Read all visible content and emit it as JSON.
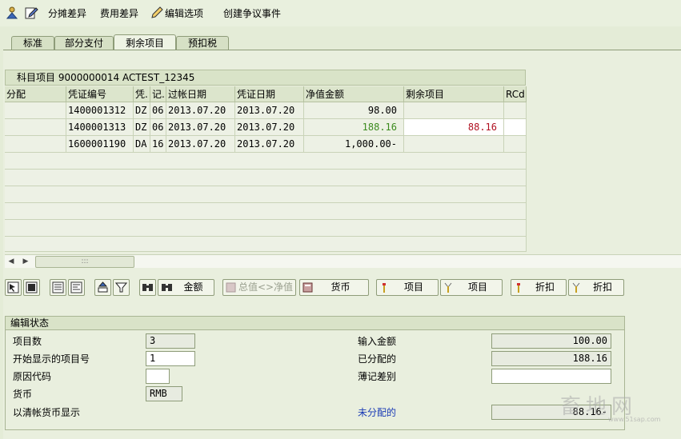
{
  "toolbar": {
    "distribute_diff": "分摊差异",
    "expense_diff": "费用差异",
    "edit_options": "编辑选项",
    "create_dispute": "创建争议事件"
  },
  "tabs": [
    "标准",
    "部分支付",
    "剩余项目",
    "预扣税"
  ],
  "active_tab": "剩余项目",
  "grid": {
    "title": "科目项目 9000000014 ACTEST_12345",
    "columns": [
      "分配",
      "凭证编号",
      "凭.",
      "记.",
      "过帐日期",
      "凭证日期",
      "净值金额",
      "剩余项目",
      "RCd"
    ],
    "rows": [
      {
        "alloc": "",
        "doc_no": "1400001312",
        "doc_type": "DZ",
        "post_key": "06",
        "posting_date": "2013.07.20",
        "doc_date": "2013.07.20",
        "net_amount": "98.00",
        "residual": "",
        "rcd": ""
      },
      {
        "alloc": "",
        "doc_no": "1400001313",
        "doc_type": "DZ",
        "post_key": "06",
        "posting_date": "2013.07.20",
        "doc_date": "2013.07.20",
        "net_amount": "188.16",
        "residual": "88.16",
        "rcd": ""
      },
      {
        "alloc": "",
        "doc_no": "1600001190",
        "doc_type": "DA",
        "post_key": "16",
        "posting_date": "2013.07.20",
        "doc_date": "2013.07.20",
        "net_amount": "1,000.00-",
        "residual": "",
        "rcd": ""
      }
    ]
  },
  "buttons": {
    "amount": "金额",
    "gross_net": "总值<>净值",
    "currency": "货币",
    "item1": "项目",
    "item2": "项目",
    "discount1": "折扣",
    "discount2": "折扣"
  },
  "edit_status": {
    "title": "编辑状态",
    "item_count_label": "项目数",
    "item_count": "3",
    "first_item_label": "开始显示的项目号",
    "first_item": "1",
    "reason_code_label": "原因代码",
    "reason_code": "",
    "currency_label": "货币",
    "currency": "RMB",
    "clearing_currency_label": "以清帐货币显示",
    "entered_amount_label": "输入金额",
    "entered_amount": "100.00",
    "assigned_label": "已分配的",
    "assigned": "188.16",
    "posting_diff_label": "薄记差别",
    "posting_diff": "",
    "unassigned_label": "未分配的",
    "unassigned": "88.16-"
  },
  "watermark": "畜地网",
  "watermark_url": "www.51sap.com",
  "colors": {
    "green_amount": "#3b8a1d",
    "red_amount": "#b01020",
    "link_blue": "#1a3bb5"
  }
}
